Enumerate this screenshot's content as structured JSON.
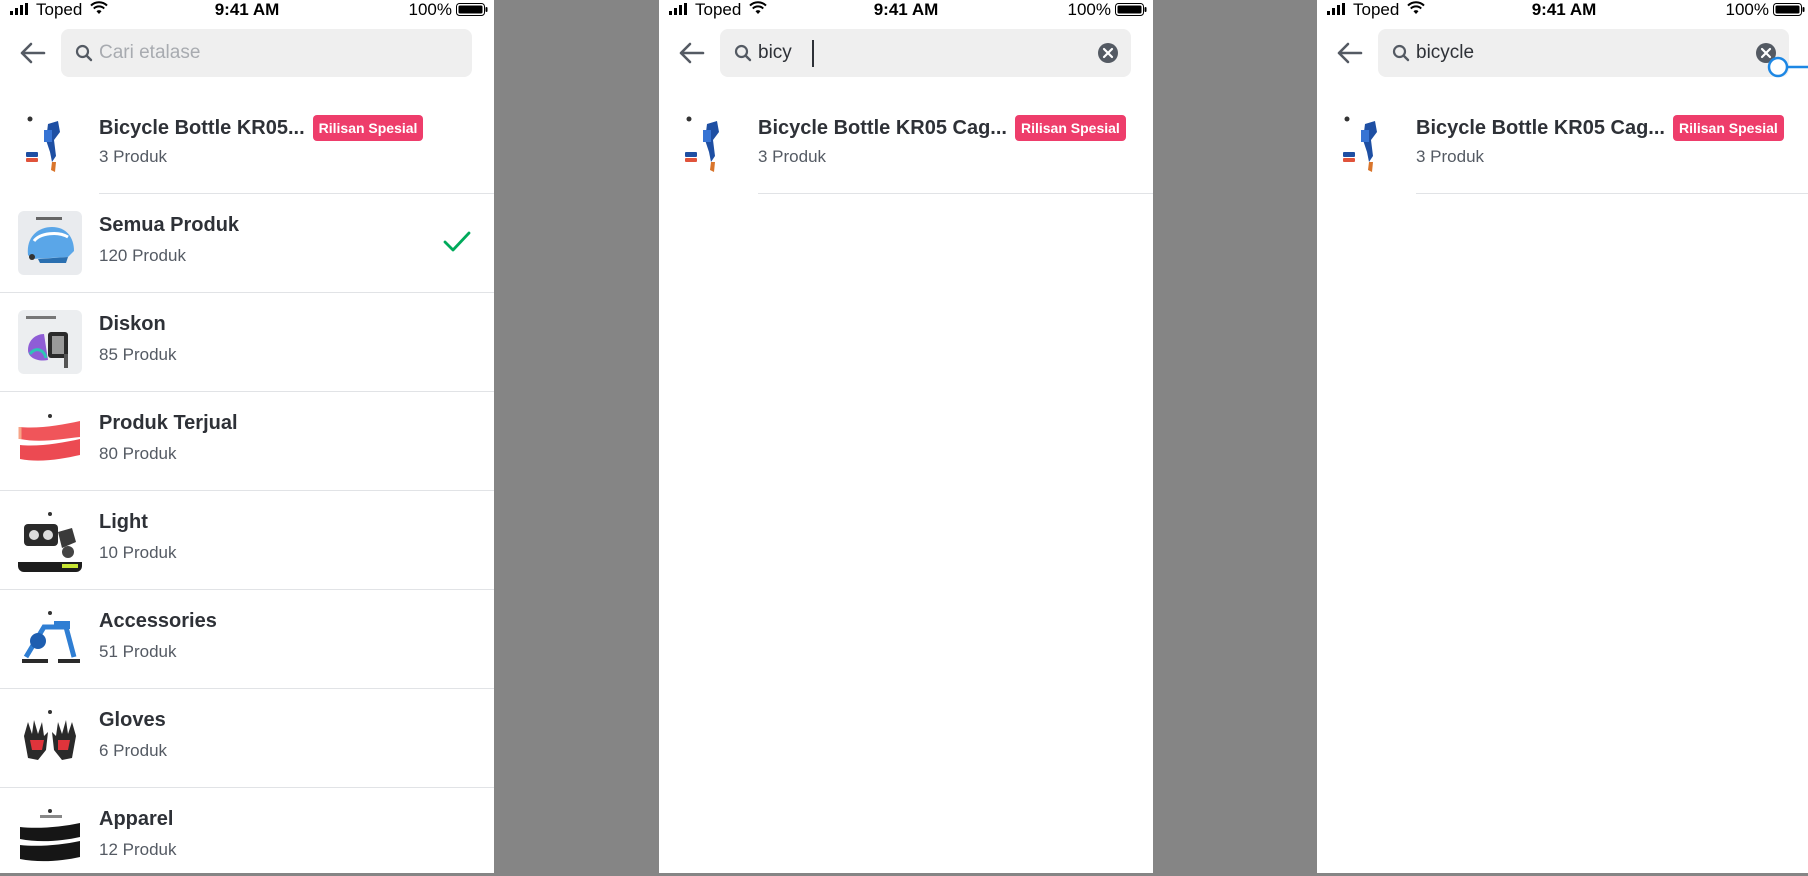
{
  "status_bar": {
    "carrier": "Toped",
    "time": "9:41 AM",
    "battery": "100%"
  },
  "search": {
    "placeholder": "Cari etalase",
    "query_partial": "bicy",
    "query_full": "bicycle"
  },
  "colors": {
    "badge": "#ee3d6b",
    "check": "#00aa5b",
    "drag": "#1d87e4"
  },
  "screen_a": {
    "items": [
      {
        "title": "Bicycle Bottle KR05...",
        "badge": "Rilisan Spesial",
        "count": "3 Produk",
        "thumb": "bottle-cage"
      },
      {
        "title": "Semua Produk",
        "count": "120 Produk",
        "thumb": "helmet",
        "selected": true
      },
      {
        "title": "Diskon",
        "count": "85 Produk",
        "thumb": "pedals"
      },
      {
        "title": "Produk Terjual",
        "count": "80 Produk",
        "thumb": "arm-sleeves-red"
      },
      {
        "title": "Light",
        "count": "10 Produk",
        "thumb": "bike-light"
      },
      {
        "title": "Accessories",
        "count": "51 Produk",
        "thumb": "bike-trainer"
      },
      {
        "title": "Gloves",
        "count": "6 Produk",
        "thumb": "gloves"
      },
      {
        "title": "Apparel",
        "count": "12 Produk",
        "thumb": "arm-sleeves-black"
      }
    ]
  },
  "screen_b": {
    "items": [
      {
        "title": "Bicycle Bottle KR05 Cag...",
        "badge": "Rilisan Spesial",
        "count": "3 Produk",
        "thumb": "bottle-cage"
      }
    ]
  },
  "screen_c": {
    "items": [
      {
        "title": "Bicycle Bottle KR05 Cag...",
        "badge": "Rilisan Spesial",
        "count": "3 Produk",
        "thumb": "bottle-cage"
      }
    ]
  }
}
